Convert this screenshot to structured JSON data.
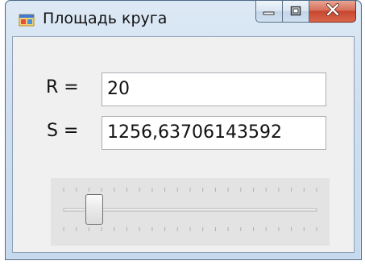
{
  "window": {
    "title": "Площадь круга",
    "icons": {
      "app": "app-window-icon",
      "minimize": "minimize-icon",
      "maximize": "maximize-icon",
      "close": "close-icon"
    }
  },
  "form": {
    "radius_label": "R =",
    "radius_value": "20",
    "area_label": "S =",
    "area_value": "1256,63706143592"
  },
  "trackbar": {
    "min": 0,
    "max": 100,
    "value": 12,
    "tick_count": 21
  },
  "colors": {
    "close_button": "#c7452e",
    "client_background": "#f0f0f0",
    "trackbar_background": "#e3e3e3"
  }
}
